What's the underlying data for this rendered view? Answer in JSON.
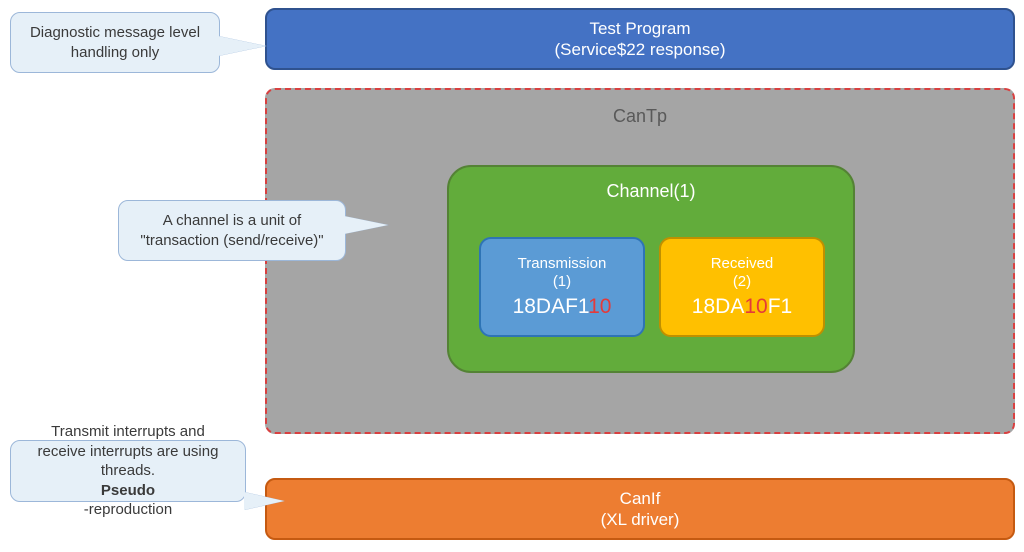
{
  "colors": {
    "blue": "#4472C4",
    "blue_border": "#2F528F",
    "grey": "#A5A5A5",
    "red_dash": "#d84040",
    "green": "#62AC3B",
    "green_border": "#548235",
    "lightblue": "#5B9BD5",
    "lightblue_border": "#2E74B5",
    "gold": "#FFC000",
    "gold_border": "#BF9000",
    "orange": "#ED7D31",
    "orange_border": "#C55A11",
    "bubble": "#E6F0F8",
    "highlight_red": "#e43a3a"
  },
  "test_program": {
    "line1": "Test Program",
    "line2": "(Service$22 response)"
  },
  "cantp": {
    "title": "CanTp",
    "channel": {
      "title": "Channel(1)",
      "tx": {
        "label_line1": "Transmission",
        "label_line2": "(1)",
        "id_prefix": "18DAF1",
        "id_highlight": "10",
        "id_suffix": ""
      },
      "rx": {
        "label_line1": "Received",
        "label_line2": "(2)",
        "id_prefix": "18DA",
        "id_highlight": "10",
        "id_suffix": "F1"
      }
    }
  },
  "canif": {
    "line1": "CanIf",
    "line2": "(XL driver)"
  },
  "callouts": {
    "diag": "Diagnostic message level handling only",
    "channel": "A channel is a unit of \"transaction (send/receive)\"",
    "canif_pre": "Transmit interrupts and receive interrupts are using threads. ",
    "canif_bold": "Pseudo",
    "canif_post": "-reproduction"
  }
}
